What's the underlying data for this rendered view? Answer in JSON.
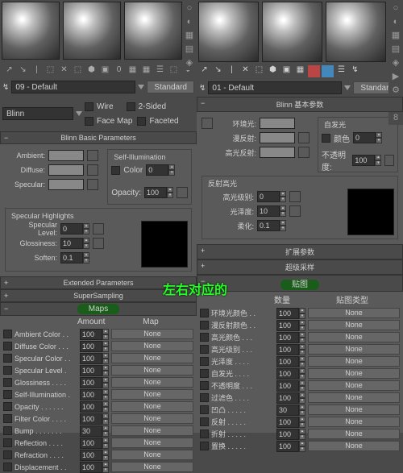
{
  "annotation": "左右对应的",
  "left": {
    "material_name": "09 - Default",
    "standard_btn": "Standard",
    "shader": "Blinn",
    "shader_opts": {
      "wire": "Wire",
      "twosided": "2-Sided",
      "facemap": "Face Map",
      "faceted": "Faceted"
    },
    "sections": {
      "basic": "Blinn Basic Parameters",
      "extended": "Extended Parameters",
      "supersampling": "SuperSampling",
      "maps": "Maps"
    },
    "basic": {
      "self_illum": "Self-Illumination",
      "ambient": "Ambient:",
      "diffuse": "Diffuse:",
      "specular": "Specular:",
      "color": "Color",
      "color_val": "0",
      "opacity": "Opacity:",
      "opacity_val": "100"
    },
    "spec": {
      "title": "Specular Highlights",
      "level": "Specular Level:",
      "level_val": "0",
      "gloss": "Glossiness:",
      "gloss_val": "10",
      "soften": "Soften:",
      "soften_val": "0.1"
    },
    "maps_cols": {
      "amount": "Amount",
      "map": "Map"
    },
    "maps": [
      {
        "name": "Ambient Color . .",
        "val": "100",
        "slot": "None"
      },
      {
        "name": "Diffuse Color . . .",
        "val": "100",
        "slot": "None"
      },
      {
        "name": "Specular Color . .",
        "val": "100",
        "slot": "None"
      },
      {
        "name": "Specular Level .",
        "val": "100",
        "slot": "None"
      },
      {
        "name": "Glossiness . . . .",
        "val": "100",
        "slot": "None"
      },
      {
        "name": "Self-Illumination .",
        "val": "100",
        "slot": "None"
      },
      {
        "name": "Opacity . . . . . .",
        "val": "100",
        "slot": "None"
      },
      {
        "name": "Filter Color . . . .",
        "val": "100",
        "slot": "None"
      },
      {
        "name": "Bump . . . . . . .",
        "val": "30",
        "slot": "None"
      },
      {
        "name": "Reflection . . . .",
        "val": "100",
        "slot": "None"
      },
      {
        "name": "Refraction . . . .",
        "val": "100",
        "slot": "None"
      },
      {
        "name": "Displacement . .",
        "val": "100",
        "slot": "None"
      }
    ]
  },
  "right": {
    "material_name": "01 - Default",
    "standard_btn": "Standard",
    "shader": "Blinn",
    "sections": {
      "basic": "Blinn 基本参数",
      "extended": "扩展参数",
      "supersampling": "超级采样",
      "maps": "贴图"
    },
    "basic": {
      "self_illum": "自发光",
      "ambient": "环境光:",
      "diffuse": "漫反射:",
      "specular": "高光反射:",
      "color": "颜色",
      "color_val": "0",
      "opacity": "不透明度:",
      "opacity_val": "100"
    },
    "spec": {
      "title": "反射高光",
      "level": "高光级别:",
      "level_val": "0",
      "gloss": "光泽度:",
      "gloss_val": "10",
      "soften": "柔化:",
      "soften_val": "0.1"
    },
    "maps_cols": {
      "amount": "数量",
      "map": "贴图类型"
    },
    "maps": [
      {
        "name": "环境光颜色 . .",
        "val": "100",
        "slot": "None"
      },
      {
        "name": "漫反射颜色 . .",
        "val": "100",
        "slot": "None"
      },
      {
        "name": "高光颜色 . . .",
        "val": "100",
        "slot": "None"
      },
      {
        "name": "高光级别 . . .",
        "val": "100",
        "slot": "None"
      },
      {
        "name": "光泽度 . . . .",
        "val": "100",
        "slot": "None"
      },
      {
        "name": "自发光 . . . .",
        "val": "100",
        "slot": "None"
      },
      {
        "name": "不透明度 . . .",
        "val": "100",
        "slot": "None"
      },
      {
        "name": "过滤色 . . . .",
        "val": "100",
        "slot": "None"
      },
      {
        "name": "凹凸 . . . . .",
        "val": "30",
        "slot": "None"
      },
      {
        "name": "反射 . . . . .",
        "val": "100",
        "slot": "None"
      },
      {
        "name": "折射 . . . . .",
        "val": "100",
        "slot": "None"
      },
      {
        "name": "置换 . . . . .",
        "val": "100",
        "slot": "None"
      }
    ]
  }
}
